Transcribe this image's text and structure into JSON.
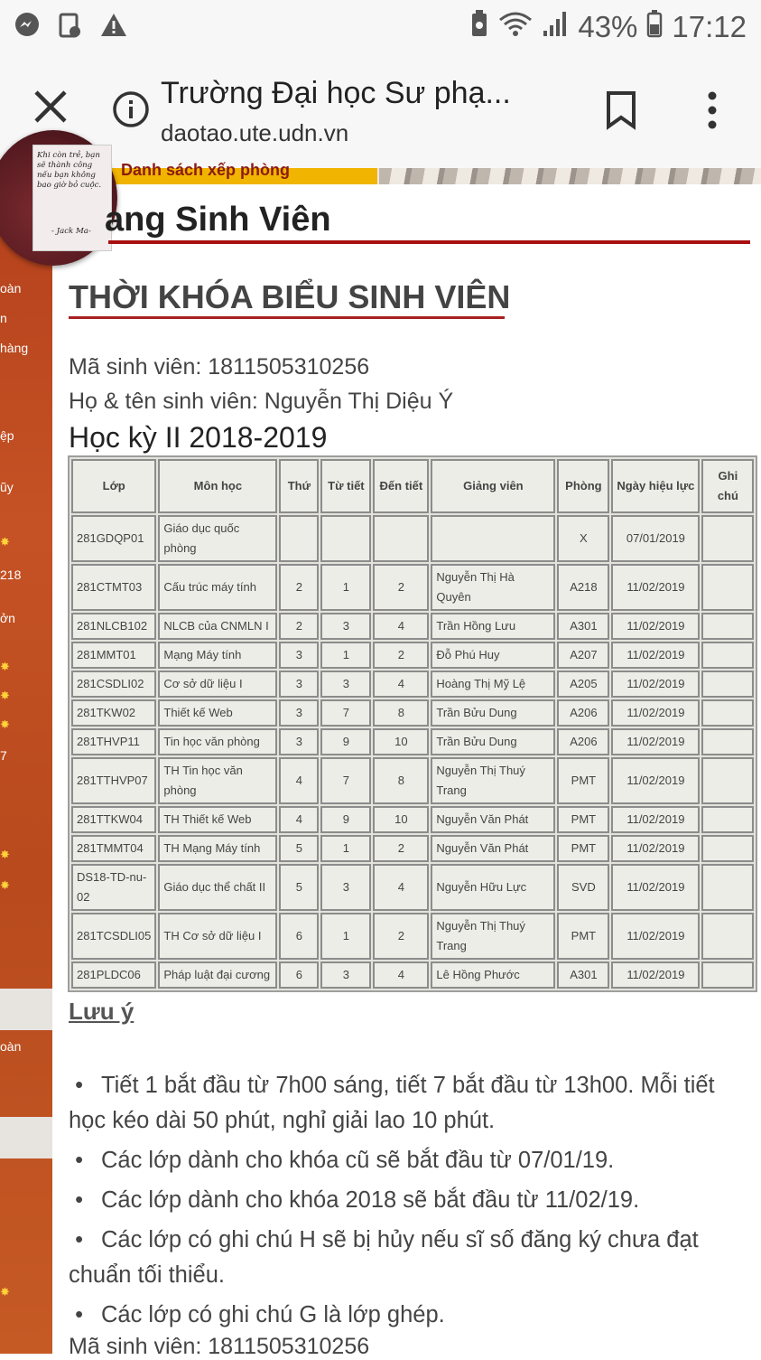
{
  "status_bar": {
    "battery": "43%",
    "time": "17:12"
  },
  "browser": {
    "page_title": "Trường Đại học Sư phạ...",
    "url": "daotao.ute.udn.vn"
  },
  "site": {
    "banner_text": "Danh sách xếp phòng",
    "heading": "ang Sinh Viên",
    "quote": {
      "text": "Khi còn trẻ, bạn sẽ thành công nếu bạn không bao giờ bỏ cuộc.",
      "author": "- Jack Ma-"
    },
    "sidebar": [
      "oàn",
      "n",
      "hàng",
      "ệp",
      "ũy",
      "218",
      "ởn",
      "7",
      "oàn"
    ]
  },
  "timetable": {
    "title": "THỜI KHÓA BIỂU SINH VIÊN",
    "student_id_line": "Mã sinh viên: 1811505310256",
    "student_name_line": "Họ & tên sinh viên: Nguyễn Thị Diệu  Ý",
    "semester": "Học kỳ II 2018-2019",
    "headers": [
      "Lớp",
      "Môn học",
      "Thứ",
      "Từ tiết",
      "Đến tiết",
      "Giảng viên",
      "Phòng",
      "Ngày hiệu lực",
      "Ghi chú"
    ],
    "rows": [
      [
        "281GDQP01",
        "Giáo dục quốc phòng",
        "",
        "",
        "",
        "",
        "X",
        "07/01/2019",
        ""
      ],
      [
        "281CTMT03",
        "Cấu trúc máy tính",
        "2",
        "1",
        "2",
        "Nguyễn Thị Hà Quyên",
        "A218",
        "11/02/2019",
        ""
      ],
      [
        "281NLCB102",
        "NLCB của CNMLN I",
        "2",
        "3",
        "4",
        "Trần Hồng Lưu",
        "A301",
        "11/02/2019",
        ""
      ],
      [
        "281MMT01",
        "Mạng Máy tính",
        "3",
        "1",
        "2",
        "Đỗ Phú Huy",
        "A207",
        "11/02/2019",
        ""
      ],
      [
        "281CSDLI02",
        "Cơ sở dữ liệu I",
        "3",
        "3",
        "4",
        "Hoàng Thị Mỹ Lệ",
        "A205",
        "11/02/2019",
        ""
      ],
      [
        "281TKW02",
        "Thiết kế Web",
        "3",
        "7",
        "8",
        "Trần Bửu Dung",
        "A206",
        "11/02/2019",
        ""
      ],
      [
        "281THVP11",
        "Tin học văn phòng",
        "3",
        "9",
        "10",
        "Trần Bửu Dung",
        "A206",
        "11/02/2019",
        ""
      ],
      [
        "281TTHVP07",
        "TH Tin học văn phòng",
        "4",
        "7",
        "8",
        "Nguyễn Thị Thuý Trang",
        "PMT",
        "11/02/2019",
        ""
      ],
      [
        "281TTKW04",
        "TH Thiết kế Web",
        "4",
        "9",
        "10",
        "Nguyễn Văn Phát",
        "PMT",
        "11/02/2019",
        ""
      ],
      [
        "281TMMT04",
        "TH Mạng Máy tính",
        "5",
        "1",
        "2",
        "Nguyễn Văn Phát",
        "PMT",
        "11/02/2019",
        ""
      ],
      [
        "DS18-TD-nu-02",
        "Giáo dục thể chất II",
        "5",
        "3",
        "4",
        "Nguyễn Hữu Lực",
        "SVD",
        "11/02/2019",
        ""
      ],
      [
        "281TCSDLI05",
        "TH Cơ sở dữ liệu I",
        "6",
        "1",
        "2",
        "Nguyễn Thị Thuý Trang",
        "PMT",
        "11/02/2019",
        ""
      ],
      [
        "281PLDC06",
        "Pháp luật đại cương",
        "6",
        "3",
        "4",
        "Lê Hồng Phước",
        "A301",
        "11/02/2019",
        ""
      ]
    ]
  },
  "notes": {
    "title": "Lưu ý",
    "items": [
      "Tiết 1 bắt đầu từ 7h00 sáng, tiết 7 bắt đầu từ 13h00. Mỗi tiết học kéo dài 50 phút, nghỉ giải lao 10 phút.",
      "Các lớp dành cho khóa cũ sẽ bắt đầu từ 07/01/19.",
      "Các lớp dành cho khóa 2018 sẽ bắt đầu từ 11/02/19.",
      "Các lớp có ghi chú H sẽ bị hủy nếu sĩ số đăng ký chưa đạt chuẩn tối thiểu.",
      "Các lớp có ghi chú G là lớp ghép."
    ],
    "footer_line": "Mã sinh viên: 1811505310256"
  },
  "colors": {
    "accent": "#a80f0f",
    "sidebar": "#c05020",
    "banner": "#f1b400"
  }
}
